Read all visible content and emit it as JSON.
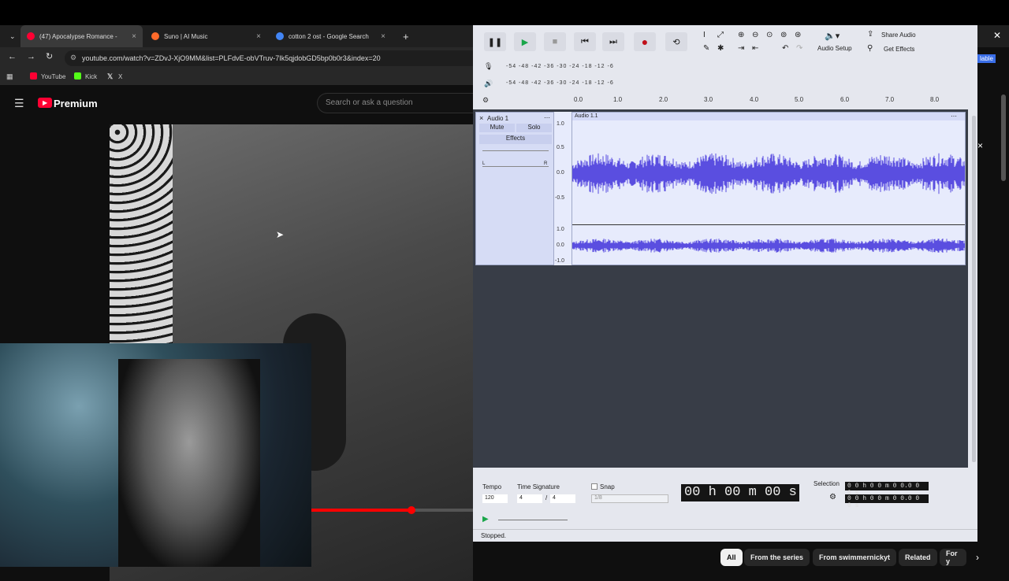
{
  "browser": {
    "tabs": [
      {
        "label": "(47) Apocalypse Romance -",
        "favicon_color": "#ff0033"
      },
      {
        "label": "Suno | AI Music",
        "favicon_color": "#ff6a2a"
      },
      {
        "label": "cotton 2 ost - Google Search",
        "favicon_color": "#4285f4"
      }
    ],
    "url": "youtube.com/watch?v=ZDvJ-XjO9MM&list=PLFdvE-obVTruv-7Ik5qjdobGD5bp0b0r3&index=20",
    "bookmarks": [
      "YouTube",
      "Kick",
      "X"
    ]
  },
  "youtube": {
    "logo_text": "Premium",
    "search_placeholder": "Search or ask a question",
    "chips": [
      "All",
      "From the series",
      "From swimmernickyt",
      "Related",
      "For y"
    ],
    "edge_text": "lable",
    "progress": 0.62
  },
  "audacity": {
    "audio_setup": "Audio Setup",
    "share_audio": "Share Audio",
    "get_effects": "Get Effects",
    "meter_scale": "-54  -48  -42  -36  -30  -24  -18  -12   -6",
    "ruler_ticks": [
      "0.0",
      "1.0",
      "2.0",
      "3.0",
      "4.0",
      "5.0",
      "6.0",
      "7.0",
      "8.0"
    ],
    "track": {
      "name": "Audio 1",
      "clip_name": "Audio 1.1",
      "mute": "Mute",
      "solo": "Solo",
      "effects": "Effects",
      "pan_left": "L",
      "pan_right": "R",
      "scale_top": [
        "1.0",
        "0.5",
        "0.0",
        "-0.5"
      ],
      "scale_bottom": [
        "1.0",
        "0.0",
        "-1.0"
      ]
    },
    "wave_color": "#5a4ee0",
    "tempo_label": "Tempo",
    "tempo_value": "120",
    "time_sig_label": "Time Signature",
    "time_sig_num": "4",
    "time_sig_den": "4",
    "snap_label": "Snap",
    "snap_value": "1/8",
    "time_display": "00 h 00 m 00 s",
    "selection_label": "Selection",
    "selection_start": "0 0 h 0 0 m 0 0.0 0 0 s",
    "selection_end": "0 0 h 0 0 m 0 0.0 0 0 s",
    "status": "Stopped."
  }
}
